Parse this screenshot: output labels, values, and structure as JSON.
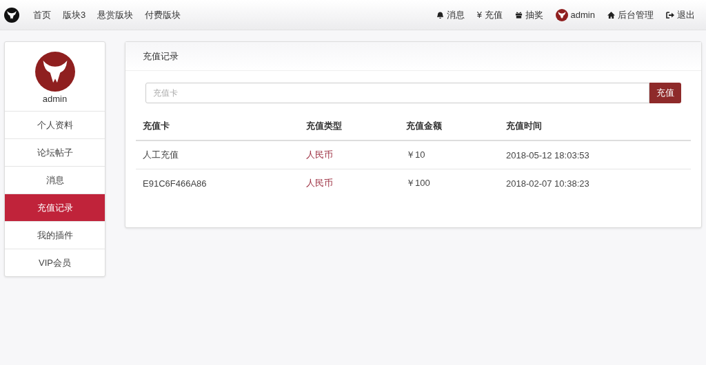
{
  "navbar": {
    "links": [
      {
        "label": "首页"
      },
      {
        "label": "版块3"
      },
      {
        "label": "悬赏版块"
      },
      {
        "label": "付费版块"
      }
    ],
    "right": [
      {
        "kind": "bell",
        "label": "消息"
      },
      {
        "kind": "none",
        "label": "¥ 充值"
      },
      {
        "kind": "gift",
        "label": "抽奖"
      },
      {
        "kind": "avatar",
        "label": "admin"
      },
      {
        "kind": "home",
        "label": "后台管理"
      },
      {
        "kind": "logout",
        "label": "退出"
      }
    ]
  },
  "sidebar": {
    "username": "admin",
    "items": [
      {
        "label": "个人资料",
        "selected": false
      },
      {
        "label": "论坛帖子",
        "selected": false
      },
      {
        "label": "消息",
        "selected": false
      },
      {
        "label": "充值记录",
        "selected": true
      },
      {
        "label": "我的插件",
        "selected": false
      },
      {
        "label": "VIP会员",
        "selected": false
      }
    ]
  },
  "panel": {
    "title": "充值记录",
    "search": {
      "placeholder": "充值卡"
    },
    "button": "充值",
    "table": {
      "columns": [
        "充值卡",
        "充值类型",
        "充值金额",
        "充值时间"
      ],
      "rows": [
        [
          "人工充值",
          "人民币",
          "￥10",
          "2018-05-12 18:03:53"
        ],
        [
          "E91C6F466A86",
          "人民币",
          "￥100",
          "2018-02-07 10:38:23"
        ]
      ]
    }
  }
}
